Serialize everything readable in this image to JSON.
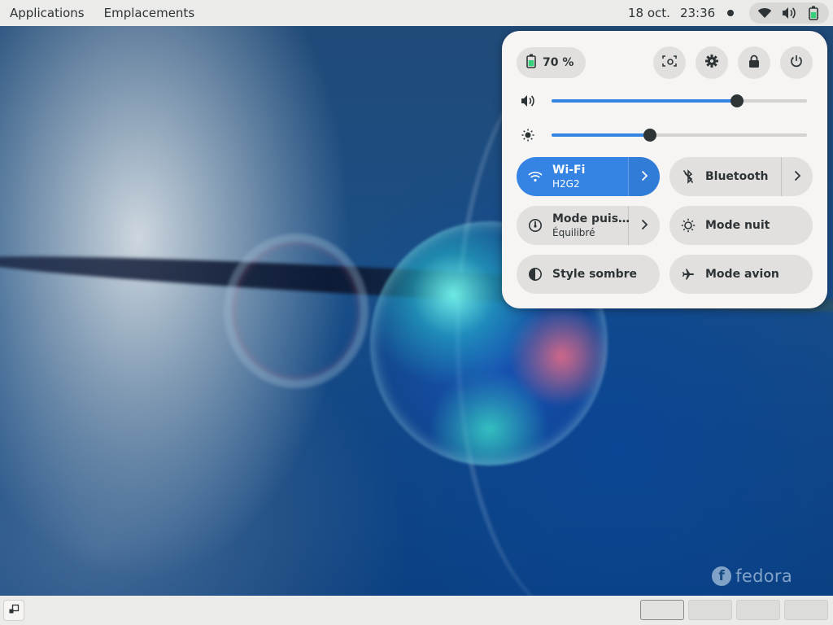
{
  "topbar": {
    "applications_label": "Applications",
    "places_label": "Emplacements",
    "date": "18 oct.",
    "time": "23:36",
    "status_icons": [
      "wifi-icon",
      "volume-icon",
      "battery-icon"
    ]
  },
  "quick_settings": {
    "battery": {
      "label": "70 %",
      "icon": "battery-charging-icon"
    },
    "action_buttons": [
      {
        "name": "screenshot-button",
        "icon": "screenshot-icon"
      },
      {
        "name": "settings-button",
        "icon": "gear-icon"
      },
      {
        "name": "lock-button",
        "icon": "lock-icon"
      },
      {
        "name": "power-button",
        "icon": "power-icon"
      }
    ],
    "volume": {
      "icon": "volume-icon",
      "level": 0.725
    },
    "brightness": {
      "icon": "brightness-icon",
      "level": 0.385
    },
    "toggles": {
      "wifi": {
        "title": "Wi-Fi",
        "subtitle": "H2G2",
        "on": true
      },
      "bluetooth": {
        "title": "Bluetooth",
        "on": false
      },
      "power_mode": {
        "title": "Mode puis…",
        "subtitle": "Équilibré",
        "on": false
      },
      "night_mode": {
        "title": "Mode nuit",
        "on": false
      },
      "dark_style": {
        "title": "Style sombre",
        "on": false
      },
      "airplane_mode": {
        "title": "Mode avion",
        "on": false
      }
    },
    "accent_color": "#3584e4"
  },
  "desktop": {
    "logo_text": "fedora"
  },
  "bottombar": {
    "workspaces": [
      {
        "index": 1,
        "active": true
      },
      {
        "index": 2,
        "active": false
      },
      {
        "index": 3,
        "active": false
      },
      {
        "index": 4,
        "active": false
      }
    ]
  }
}
